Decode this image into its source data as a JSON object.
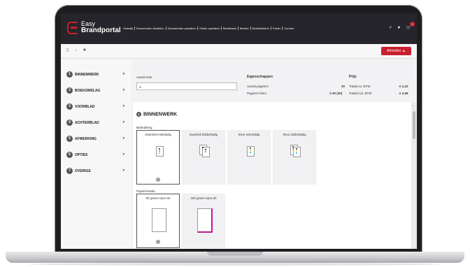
{
  "header": {
    "brand_line1": "Easy",
    "brand_line2": "Brandportal",
    "nav": [
      "Huisstijl",
      "Documenten bestellen",
      "Documenten opmaken",
      "Online opmaken",
      "Beeldbank",
      "Beheer",
      "Bestelhistorie",
      "Folder",
      "Contact"
    ],
    "search_icon": "⌕",
    "user_icon": "●",
    "cart_icon": "🛒",
    "cart_count": "3"
  },
  "toolbar": {
    "afronden_label": "Afronden",
    "afronden_icon": "▲"
  },
  "sidebar": {
    "items": [
      {
        "num": "1",
        "label": "BINNENWERK"
      },
      {
        "num": "2",
        "label": "BOEKOMSLAG"
      },
      {
        "num": "3",
        "label": "VOORBLAD"
      },
      {
        "num": "4",
        "label": "ACHTERBLAD"
      },
      {
        "num": "5",
        "label": "AFWERKING"
      },
      {
        "num": "6",
        "label": "OPTIES"
      },
      {
        "num": "7",
        "label": "OVERIGE"
      }
    ],
    "chevron": "▾"
  },
  "summary": {
    "aantal_sets_label": "Aantal sets",
    "aantal_sets_value": "1",
    "eigenschappen_label": "Eigenschappen",
    "prijs_label": "Prijs",
    "rows": [
      {
        "key": "Aantal pagina's",
        "value": "30",
        "price_key": "Totaal ex. BTW",
        "price": "€ 2,22"
      },
      {
        "key": "Pagina's kleur",
        "value": "1-30 (30)",
        "price_key": "Totaal incl. BTW",
        "price": "€ 2,69"
      }
    ]
  },
  "section": {
    "num": "1",
    "title": "BINNENWERK",
    "bedrukking_label": "Bedrukking",
    "bedrukking_options": [
      "Zwart/wit enkelzijdig",
      "Zwart/wit dubbelzijdig",
      "Kleur enkelzijdig",
      "Kleur dubbelzijdig"
    ],
    "papier_label": "Papier/media",
    "papier_options": [
      "80 grams repro wit",
      "160 grams repro wit"
    ],
    "check": "✓"
  },
  "colors": {
    "accent": "#c8202f",
    "header_bg": "#25252b",
    "magenta": "#c2188c"
  }
}
